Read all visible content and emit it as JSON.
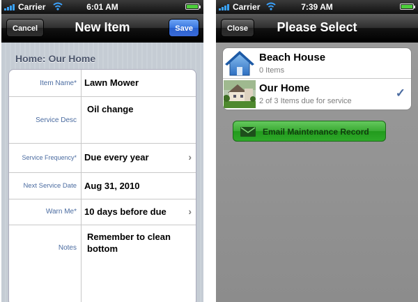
{
  "left_screen": {
    "status": {
      "carrier": "Carrier",
      "time": "6:01 AM"
    },
    "nav": {
      "title": "New Item",
      "cancel_label": "Cancel",
      "save_label": "Save"
    },
    "section_header": "Home: Our Home",
    "fields": [
      {
        "label": "Item Name*",
        "value": "Lawn Mower"
      },
      {
        "label": "Service Desc",
        "value": "Oil change"
      },
      {
        "label": "Service Frequency*",
        "value": "Due every year"
      },
      {
        "label": "Next Service Date",
        "value": "Aug 31, 2010"
      },
      {
        "label": "Warn Me*",
        "value": "10 days before due"
      },
      {
        "label": "Notes",
        "value_line1": "Remember to clean",
        "value_line2": "bottom"
      }
    ]
  },
  "right_screen": {
    "status": {
      "carrier": "Carrier",
      "time": "7:39 AM"
    },
    "nav": {
      "title": "Please Select",
      "close_label": "Close"
    },
    "homes": [
      {
        "name": "Beach House",
        "subtitle": "0 Items",
        "icon": "house-icon"
      },
      {
        "name": "Our Home",
        "subtitle": "2 of 3 Items due for service",
        "icon": "house-photo",
        "selected": true
      }
    ],
    "email_button_label": "Email Maintenance Record",
    "email_icon": "envelope-icon"
  },
  "colors": {
    "label_blue": "#4a6ba0",
    "save_blue": "#3976e0",
    "email_green": "#3aab34"
  }
}
